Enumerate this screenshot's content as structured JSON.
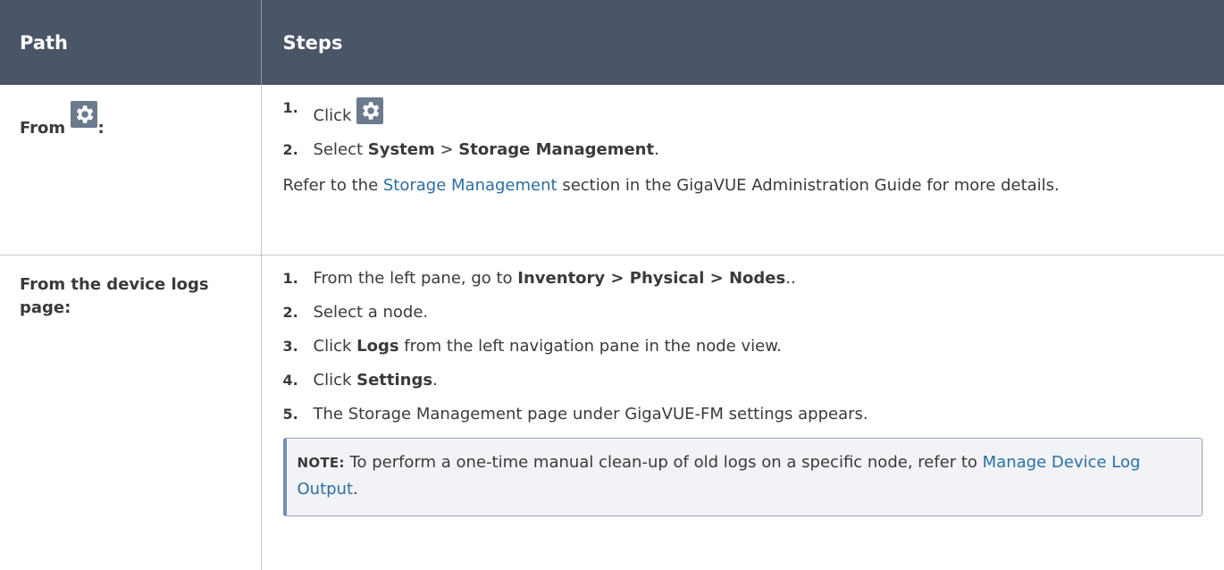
{
  "table": {
    "header": {
      "col_path": "Path",
      "col_steps": "Steps"
    },
    "row1": {
      "path_prefix": "From",
      "path_suffix": ":",
      "steps": [
        {
          "num": "1.",
          "text": "Click"
        },
        {
          "num": "2.",
          "pre": "Select ",
          "b1": "System",
          "mid": " > ",
          "b2": "Storage Management",
          "post": "."
        }
      ],
      "ref_pre": "Refer to the ",
      "ref_link": "Storage Management",
      "ref_post": " section in the GigaVUE Administration Guide for more details."
    },
    "row2": {
      "path": "From the device logs page:",
      "steps": [
        {
          "num": "1.",
          "pre": "From the left pane, go to ",
          "bold": "Inventory > Physical > Nodes",
          "post": ".."
        },
        {
          "num": "2.",
          "text": "Select a node."
        },
        {
          "num": "3.",
          "pre": "Click ",
          "bold": "Logs",
          "post": " from the left navigation pane in the node view."
        },
        {
          "num": "4.",
          "pre": "Click ",
          "bold": "Settings",
          "post": "."
        },
        {
          "num": "5.",
          "text": "The Storage Management page under GigaVUE-FM settings appears."
        }
      ],
      "note": {
        "label": "NOTE:",
        "text": " To perform a one-time manual clean-up of old logs on a specific node, refer to ",
        "link": "Manage Device Log Output",
        "end": "."
      }
    }
  },
  "icons": {
    "settings": "gear-icon"
  },
  "colors": {
    "header_bg": "#4a5568",
    "link": "#2b6fa3",
    "icon_bg": "#6b7a8c"
  }
}
